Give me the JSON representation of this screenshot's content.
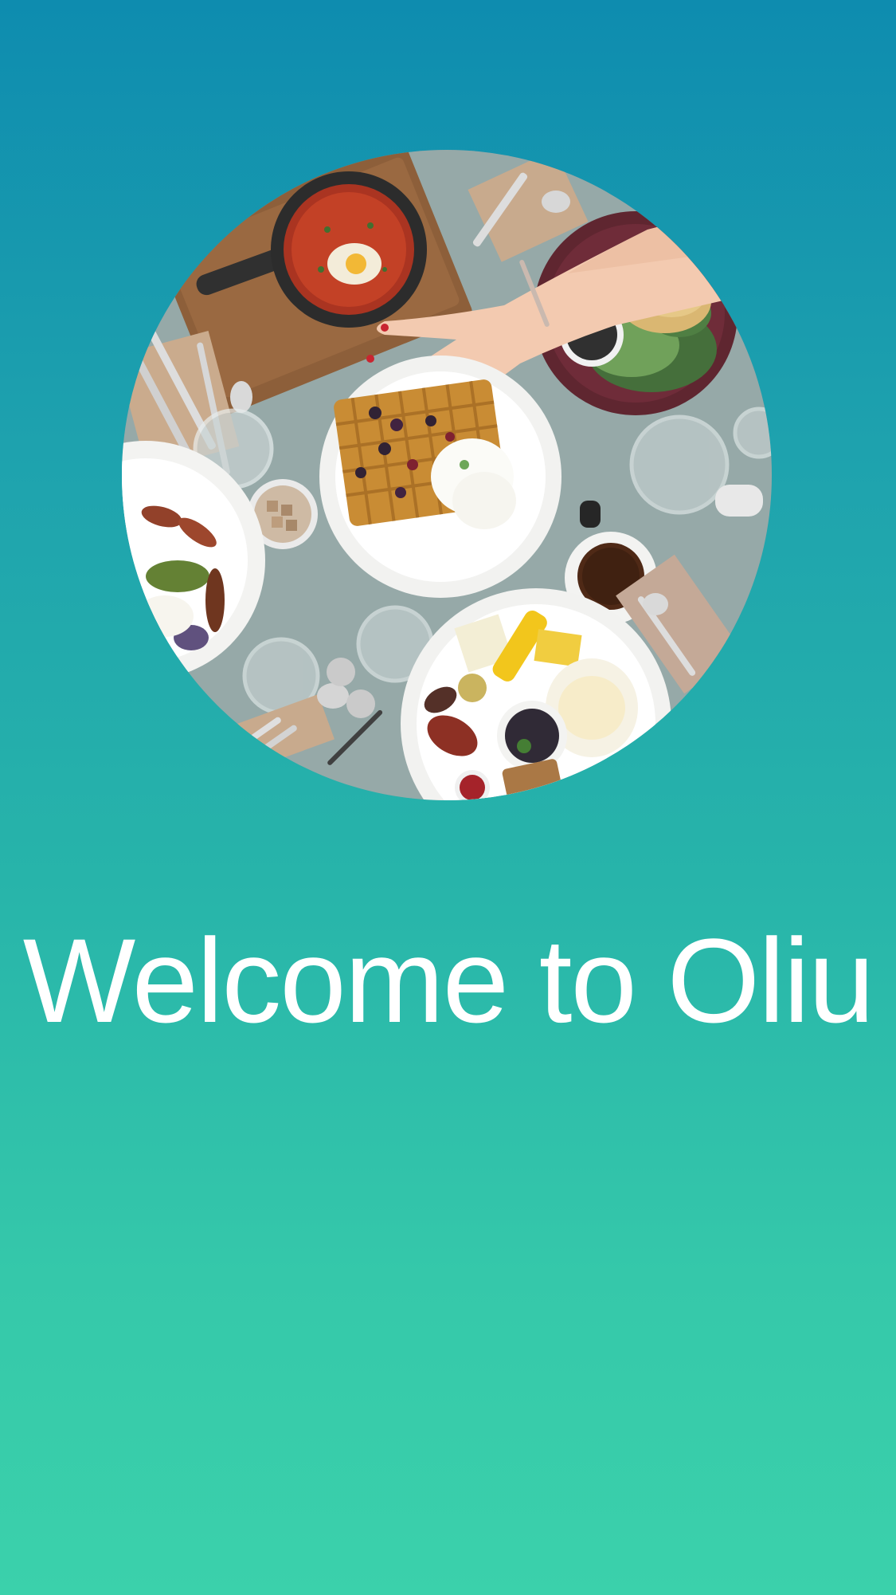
{
  "welcome": {
    "title": "Welcome to Oliu"
  },
  "hero_image": {
    "icon": "breakfast-table-photo",
    "alt": ""
  },
  "colors": {
    "gradient_top": "#0e8caf",
    "gradient_bottom": "#3bd1ab",
    "title_text": "#ffffff",
    "table_surface": "#8fa3a3"
  }
}
